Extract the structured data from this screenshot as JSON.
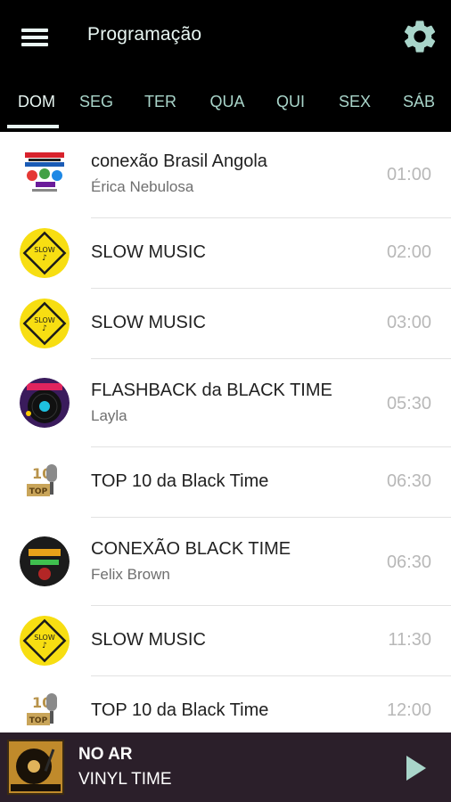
{
  "header": {
    "title": "Programação",
    "menu_icon": "hamburger-menu-icon",
    "settings_icon": "gear-icon",
    "accent_color": "#a9d5ca"
  },
  "tabs": [
    {
      "label": "DOM",
      "active": true
    },
    {
      "label": "SEG",
      "active": false
    },
    {
      "label": "TER",
      "active": false
    },
    {
      "label": "QUA",
      "active": false
    },
    {
      "label": "QUI",
      "active": false
    },
    {
      "label": "SEX",
      "active": false
    },
    {
      "label": "SÁB",
      "active": false
    }
  ],
  "schedule": [
    {
      "title": "conexão Brasil Angola",
      "host": "Érica Nebulosa",
      "time": "01:00",
      "art": "conexao-brasil-angola-logo"
    },
    {
      "title": "SLOW MUSIC",
      "host": "",
      "time": "02:00",
      "art": "slow-music-sign"
    },
    {
      "title": "SLOW MUSIC",
      "host": "",
      "time": "03:00",
      "art": "slow-music-sign"
    },
    {
      "title": "FLASHBACK da BLACK TIME",
      "host": "Layla",
      "time": "05:30",
      "art": "flashback-vinyl"
    },
    {
      "title": "TOP 10 da Black Time",
      "host": "",
      "time": "06:30",
      "art": "top10-microphone"
    },
    {
      "title": "CONEXÃO BLACK TIME",
      "host": "Felix Brown",
      "time": "06:30",
      "art": "conexao-black-time-logo"
    },
    {
      "title": "SLOW MUSIC",
      "host": "",
      "time": "11:30",
      "art": "slow-music-sign"
    },
    {
      "title": "TOP 10 da Black Time",
      "host": "",
      "time": "12:00",
      "art": "top10-microphone"
    }
  ],
  "player": {
    "label": "NO AR",
    "title": "VINYL TIME",
    "play_icon": "play-icon",
    "art": "vinyl-time-turntable",
    "background": "#2b1f2a"
  }
}
